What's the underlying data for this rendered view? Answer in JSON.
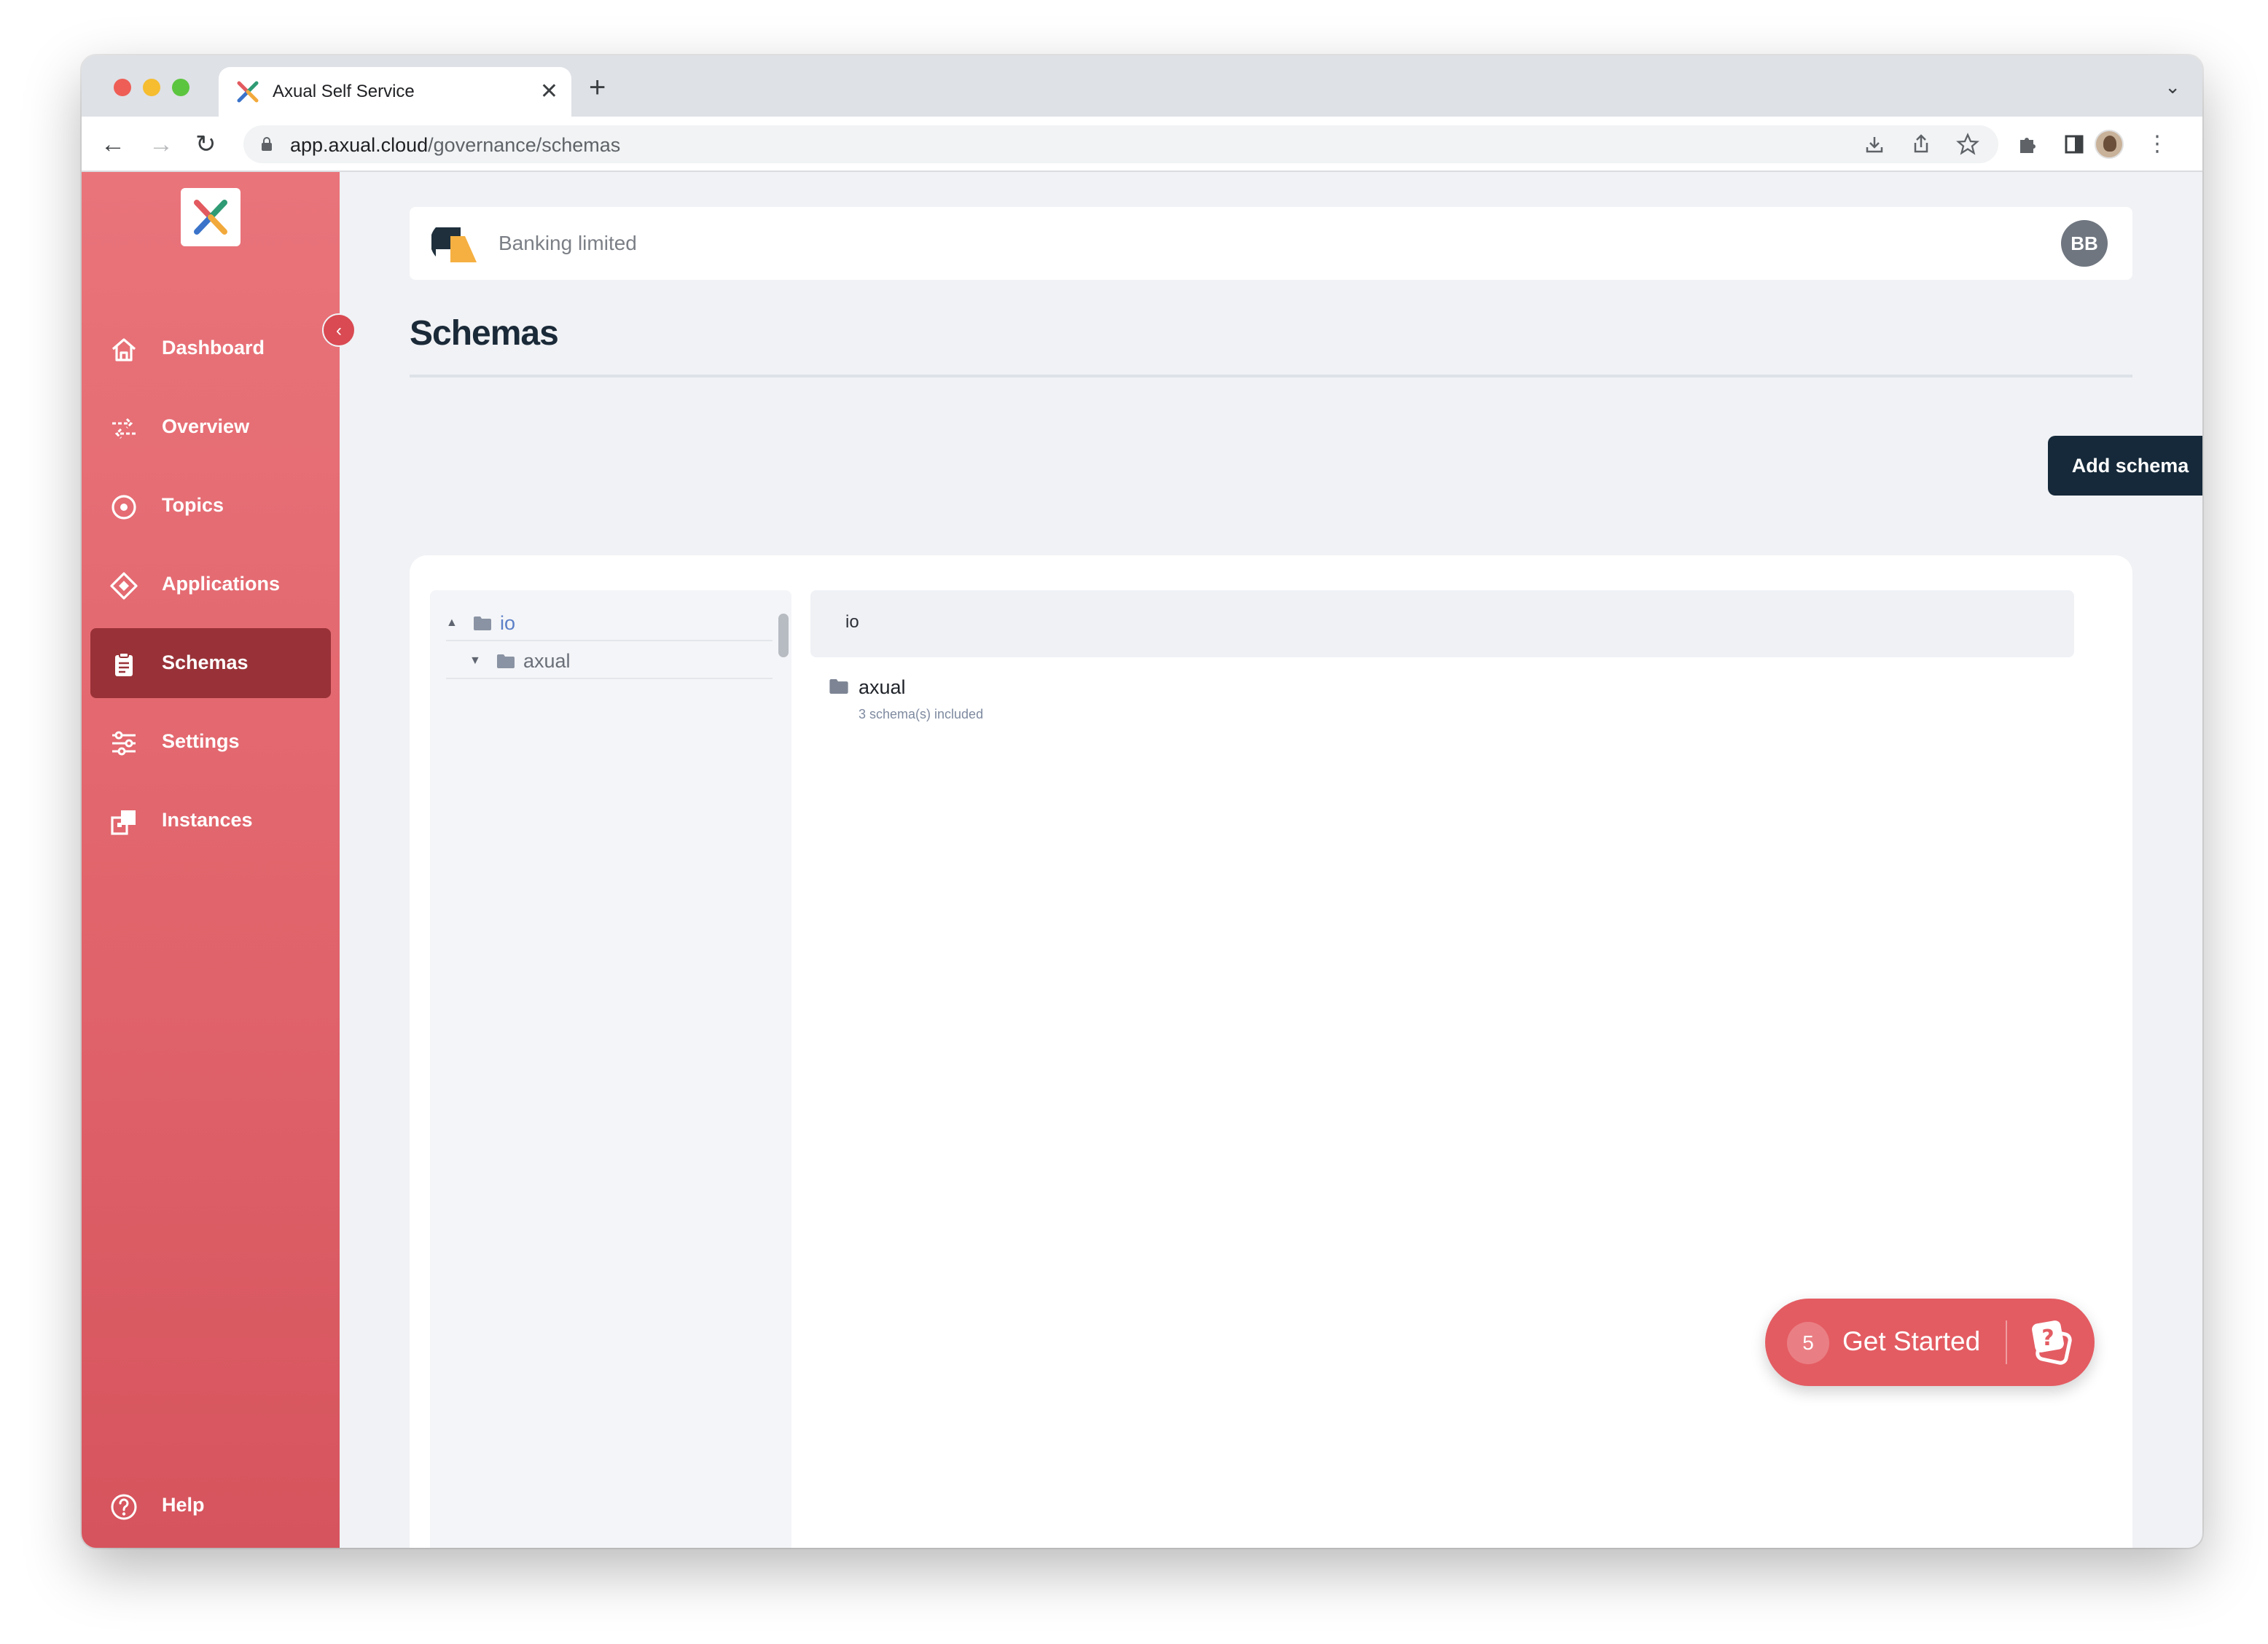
{
  "browser": {
    "tab_title": "Axual Self Service",
    "tab_close": "✕",
    "new_tab": "+",
    "url_host": "app.axual.cloud",
    "url_path": "/governance/schemas"
  },
  "sidebar": {
    "items": [
      {
        "label": "Dashboard",
        "icon": "home-icon"
      },
      {
        "label": "Overview",
        "icon": "overview-icon"
      },
      {
        "label": "Topics",
        "icon": "topic-icon"
      },
      {
        "label": "Applications",
        "icon": "application-icon"
      },
      {
        "label": "Schemas",
        "icon": "schema-icon",
        "active": true
      },
      {
        "label": "Settings",
        "icon": "settings-icon"
      },
      {
        "label": "Instances",
        "icon": "instances-icon"
      }
    ],
    "help": {
      "label": "Help",
      "icon": "help-icon"
    }
  },
  "header": {
    "org_name": "Banking limited",
    "avatar_initials": "BB"
  },
  "page": {
    "title": "Schemas",
    "add_button": "Add schema"
  },
  "tree": {
    "nodes": [
      {
        "label": "io",
        "expanded": true
      },
      {
        "label": "axual",
        "expanded": false
      }
    ]
  },
  "detail": {
    "breadcrumb": "io",
    "folders": [
      {
        "name": "axual",
        "subtitle": "3 schema(s) included"
      }
    ]
  },
  "get_started": {
    "count": "5",
    "label": "Get Started"
  },
  "colors": {
    "sidebar": "#e0626a",
    "sidebar_active": "#993238",
    "primary_button": "#15293a",
    "accent": "#e35c62",
    "tree_link": "#5b7fc7"
  }
}
